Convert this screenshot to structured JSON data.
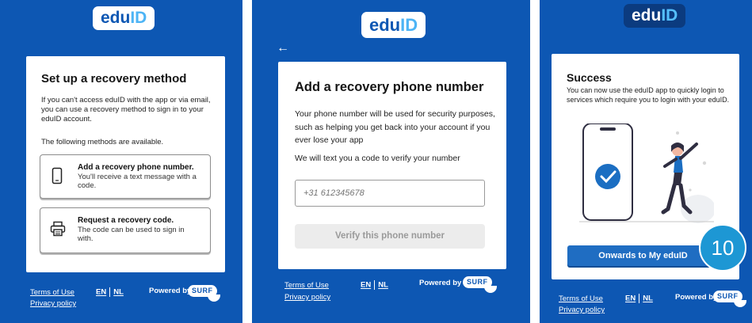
{
  "brand": {
    "logo_main": "edu",
    "logo_accent": "ID"
  },
  "panel1": {
    "title": "Set up a recovery method",
    "intro": "If you can't access eduID with the app or via email, you can use a recovery method to sign in to your eduID account.",
    "methods_text": "The following methods are available.",
    "option_phone": {
      "heading": "Add a recovery phone number.",
      "sub": "You'll receive a text message with a code.",
      "icon": "phone-icon"
    },
    "option_code": {
      "heading": "Request a recovery code.",
      "sub": "The code can be used to sign in with.",
      "icon": "printer-icon"
    }
  },
  "panel2": {
    "back_arrow": "←",
    "title": "Add a recovery phone number",
    "body": "Your phone number will be used for security purposes, such as helping you get back into your account if you ever lose your app",
    "sms_text": "We will text you a code to verify your number",
    "phone_placeholder": "+31 612345678",
    "verify_button": "Verify this phone number"
  },
  "panel3": {
    "title": "Success",
    "body": "You can now use the eduID app to quickly login to services which require you to login with your eduID.",
    "onwards_button": "Onwards to My eduID",
    "step_badge": "10"
  },
  "footer": {
    "terms": "Terms of Use",
    "privacy": "Privacy policy",
    "lang_en": "EN",
    "lang_nl": "NL",
    "powered_by": "Powered by",
    "surf": "SURF"
  },
  "colors": {
    "brand_blue": "#0d57b3",
    "accent_cyan": "#4db4f5",
    "badge": "#1d97d4",
    "button_primary": "#1f6dc2"
  }
}
